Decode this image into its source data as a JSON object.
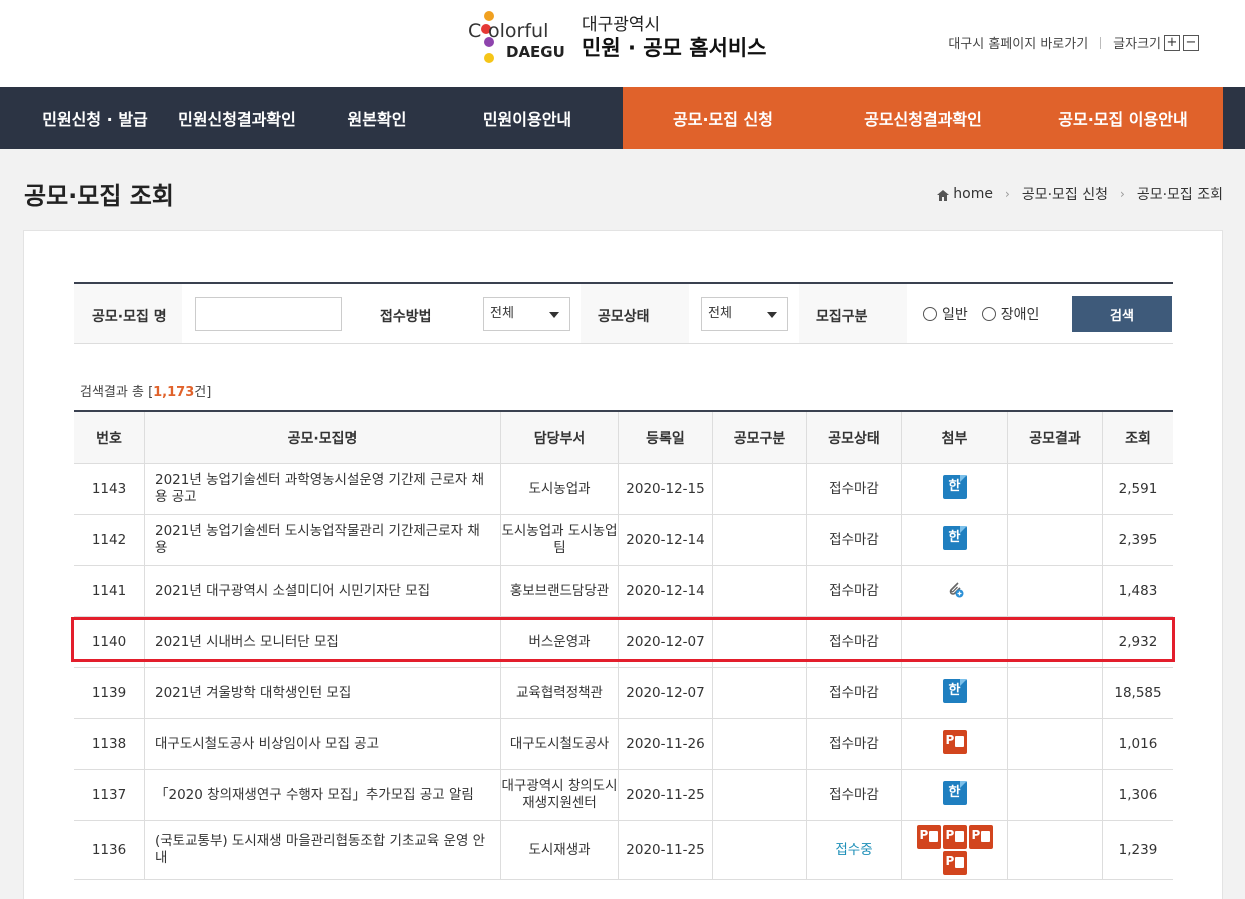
{
  "header": {
    "logo_c": "C",
    "logo_olorful": "olorful",
    "logo_daegu": "DAEGU",
    "site_sub": "대구광역시",
    "site_main": "민원 · 공모 홈서비스",
    "util_home_link": "대구시 홈페이지 바로가기",
    "util_fontsize_label": "글자크기",
    "util_plus": "+",
    "util_minus": "−"
  },
  "nav": {
    "left": [
      "민원신청 · 발급",
      "민원신청결과확인",
      "원본확인",
      "민원이용안내"
    ],
    "right": [
      "공모·모집 신청",
      "공모신청결과확인",
      "공모·모집 이용안내"
    ]
  },
  "page": {
    "title": "공모·모집 조회",
    "breadcrumb": [
      "home",
      "공모·모집 신청",
      "공모·모집 조회"
    ]
  },
  "search": {
    "name_label": "공모·모집 명",
    "name_value": "",
    "method_label": "접수방법",
    "method_value": "전체",
    "status_label": "공모상태",
    "status_value": "전체",
    "type_label": "모집구분",
    "radio_general": "일반",
    "radio_disabled": "장애인",
    "button": "검색"
  },
  "result": {
    "prefix": "검색결과 총 [",
    "count": "1,173",
    "suffix": "건]"
  },
  "table": {
    "headers": [
      "번호",
      "공모·모집명",
      "담당부서",
      "등록일",
      "공모구분",
      "공모상태",
      "첨부",
      "공모결과",
      "조회"
    ],
    "rows": [
      {
        "no": "1143",
        "title": "2021년 농업기술센터 과학영농시설운영 기간제 근로자 채용 공고",
        "dept": "도시농업과",
        "date": "2020-12-15",
        "kind": "",
        "status": "접수마감",
        "attach": [
          "hwp"
        ],
        "result": "",
        "views": "2,591"
      },
      {
        "no": "1142",
        "title": "2021년 농업기술센터 도시농업작물관리 기간제근로자 채용",
        "dept": "도시농업과 도시농업팀",
        "date": "2020-12-14",
        "kind": "",
        "status": "접수마감",
        "attach": [
          "hwp"
        ],
        "result": "",
        "views": "2,395"
      },
      {
        "no": "1141",
        "title": "2021년 대구광역시 소셜미디어 시민기자단 모집",
        "dept": "홍보브랜드담당관",
        "date": "2020-12-14",
        "kind": "",
        "status": "접수마감",
        "attach": [
          "clip"
        ],
        "result": "",
        "views": "1,483"
      },
      {
        "no": "1140",
        "title": "2021년 시내버스 모니터단 모집",
        "dept": "버스운영과",
        "date": "2020-12-07",
        "kind": "",
        "status": "접수마감",
        "attach": [],
        "result": "",
        "views": "2,932"
      },
      {
        "no": "1139",
        "title": "2021년 겨울방학 대학생인턴 모집",
        "dept": "교육협력정책관",
        "date": "2020-12-07",
        "kind": "",
        "status": "접수마감",
        "attach": [
          "hwp"
        ],
        "result": "",
        "views": "18,585"
      },
      {
        "no": "1138",
        "title": "대구도시철도공사 비상임이사 모집 공고",
        "dept": "대구도시철도공사",
        "date": "2020-11-26",
        "kind": "",
        "status": "접수마감",
        "attach": [
          "ppt"
        ],
        "result": "",
        "views": "1,016"
      },
      {
        "no": "1137",
        "title": "「2020 창의재생연구 수행자 모집」추가모집 공고 알림",
        "dept": "대구광역시 창의도시재생지원센터",
        "date": "2020-11-25",
        "kind": "",
        "status": "접수마감",
        "attach": [
          "hwp"
        ],
        "result": "",
        "views": "1,306"
      },
      {
        "no": "1136",
        "title": "(국토교통부) 도시재생 마을관리협동조합 기초교육 운영 안내",
        "dept": "도시재생과",
        "date": "2020-11-25",
        "kind": "",
        "status": "접수중",
        "attach": [
          "ppt",
          "ppt",
          "ppt",
          "ppt"
        ],
        "result": "",
        "views": "1,239"
      }
    ]
  },
  "icons": {
    "hwp_glyph": "한",
    "ppt_glyph": "P"
  },
  "colors": {
    "nav_dark": "#2c3444",
    "nav_accent": "#e0622b",
    "search_button": "#3e5a7a",
    "status_open": "#1d8fb8",
    "highlight": "#e31e2c"
  }
}
